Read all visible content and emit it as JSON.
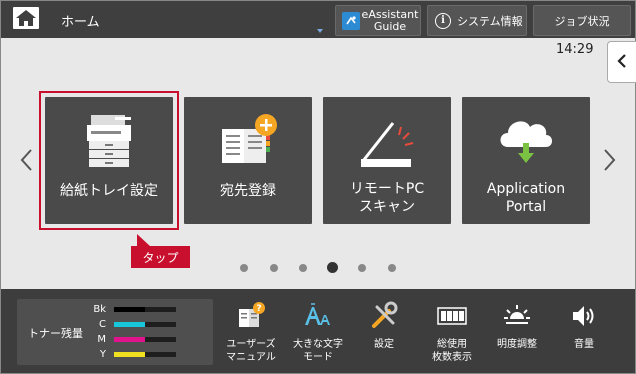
{
  "header": {
    "home_label": "ホーム",
    "eassistant_line1": "eAssistant",
    "eassistant_line2": "Guide",
    "system_info": "システム情報",
    "job_status": "ジョブ状況"
  },
  "clock": "14:29",
  "tiles": [
    {
      "line1": "給紙トレイ設定",
      "line2": "",
      "icon": "printer-icon"
    },
    {
      "line1": "宛先登録",
      "line2": "",
      "icon": "address-book-add-icon"
    },
    {
      "line1": "リモートPC",
      "line2": "スキャン",
      "icon": "scanner-icon"
    },
    {
      "line1": "Application",
      "line2": "Portal",
      "icon": "cloud-download-icon"
    }
  ],
  "callout": "タップ",
  "pagination": {
    "count": 6,
    "active_index": 3
  },
  "toner": {
    "title": "トナー残量",
    "rows": [
      {
        "label": "Bk",
        "color": "#000000",
        "level": 0.5
      },
      {
        "label": "C",
        "color": "#17c6d8",
        "level": 0.5
      },
      {
        "label": "M",
        "color": "#e0128c",
        "level": 0.5
      },
      {
        "label": "Y",
        "color": "#f0e020",
        "level": 0.5
      }
    ]
  },
  "footer_buttons": [
    {
      "line1": "ユーザーズ",
      "line2": "マニュアル",
      "icon": "manual-icon"
    },
    {
      "line1": "大きな文字",
      "line2": "モード",
      "icon": "large-text-icon"
    },
    {
      "line1": "設定",
      "line2": "",
      "icon": "settings-tools-icon"
    },
    {
      "line1": "総使用",
      "line2": "枚数表示",
      "icon": "counter-icon"
    },
    {
      "line1": "明度調整",
      "line2": "",
      "icon": "brightness-icon"
    },
    {
      "line1": "音量",
      "line2": "",
      "icon": "volume-icon"
    }
  ],
  "colors": {
    "header_bg": "#3f3f3f",
    "tile_bg": "#4a4a4a",
    "highlight": "#c8102e",
    "footer_bg": "#3d3d3d"
  }
}
